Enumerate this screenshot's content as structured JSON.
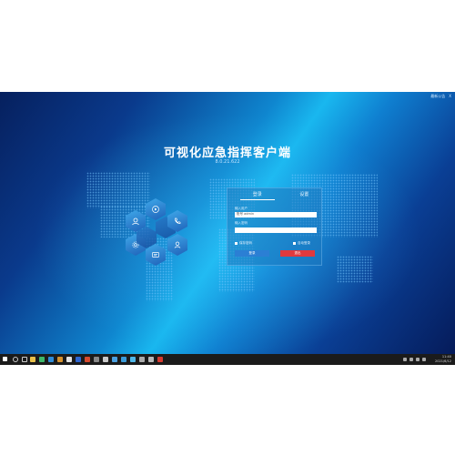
{
  "app": {
    "title": "可视化应急指挥客户端",
    "version": "8.0.21.622"
  },
  "topbar": {
    "right_text": "最新公告",
    "close_label": "X"
  },
  "login": {
    "tabs": [
      "登录",
      "设置"
    ],
    "username_label": "输入用户",
    "username_value": "账号 admin",
    "password_label": "输入密码",
    "password_value": "",
    "remember_label": "保存密码",
    "autologin_label": "自动登录",
    "login_button": "登录",
    "exit_button": "退出"
  },
  "taskbar": {
    "time": "11:40",
    "date": "2021/6/12"
  },
  "icons": [
    "windows-icon",
    "search-icon",
    "task-view-icon",
    "explorer-icon",
    "app-icon",
    "app-icon",
    "app-icon",
    "app-icon",
    "app-icon",
    "app-icon",
    "app-icon",
    "app-icon",
    "app-icon",
    "app-icon",
    "app-icon",
    "app-icon",
    "app-icon",
    "app-icon"
  ],
  "colors": {
    "background_dark": "#06205e",
    "background_light": "#19b7ef",
    "login_button": "#2b7fd4",
    "exit_button": "#e0393e",
    "taskbar": "#1b1b1b"
  }
}
